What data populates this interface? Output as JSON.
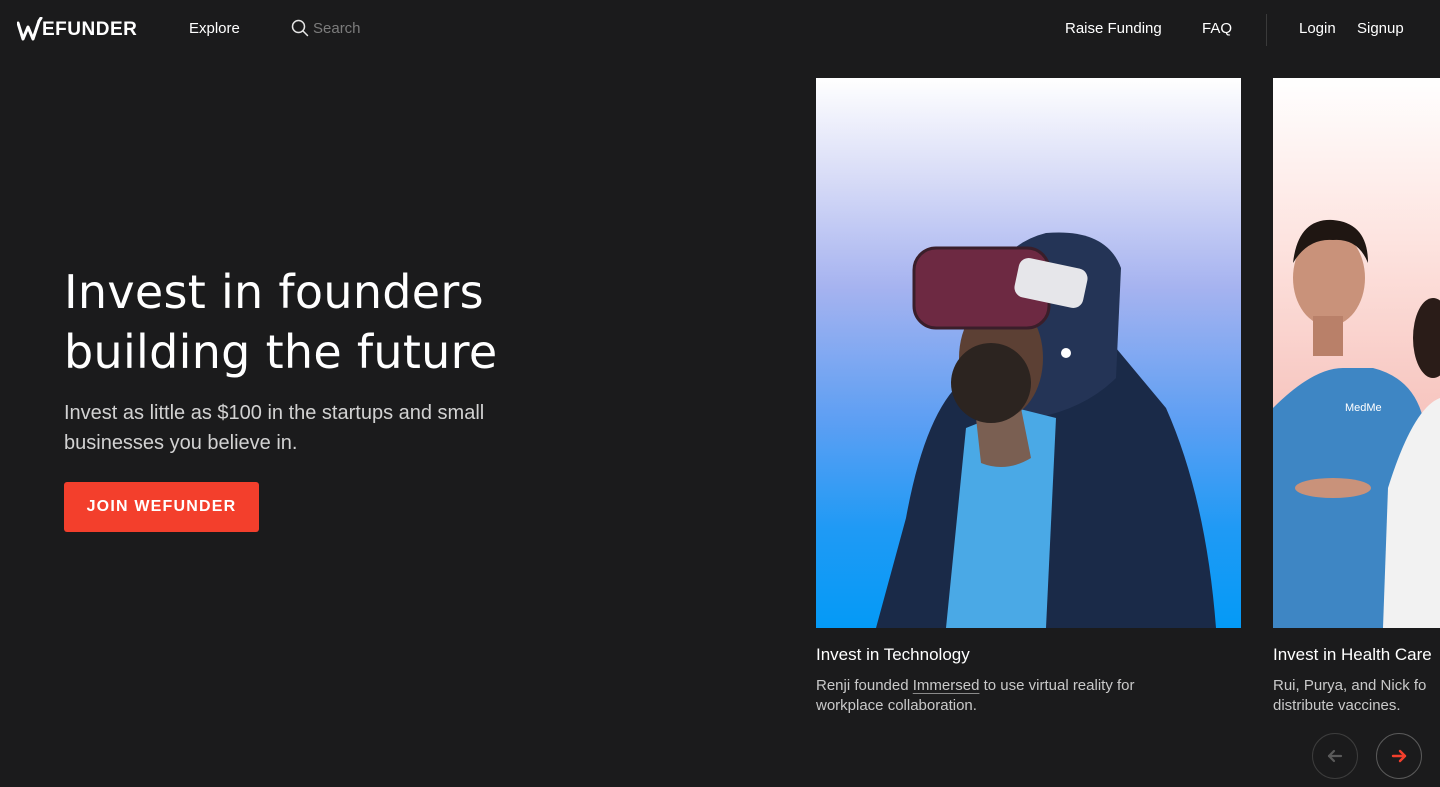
{
  "header": {
    "logo_text": "EFUNDER",
    "explore_label": "Explore",
    "search_placeholder": "Search",
    "raise_funding_label": "Raise Funding",
    "faq_label": "FAQ",
    "login_label": "Login",
    "signup_label": "Signup"
  },
  "hero": {
    "title_line1": "Invest in founders",
    "title_line2": "building the future",
    "subtitle_line1": "Invest as little as $100 in the startups and small",
    "subtitle_line2": "businesses you believe in.",
    "cta_label": "JOIN WEFUNDER"
  },
  "cards": [
    {
      "title": "Invest in Technology",
      "desc_before": "Renji founded ",
      "desc_link": "Immersed",
      "desc_after": " to use virtual reality for",
      "desc_line2": "workplace collaboration.",
      "image_icon": "vr-headset-person-image"
    },
    {
      "title": "Invest in Health Care",
      "desc_line1": "Rui, Purya, and Nick fo",
      "desc_line2": "distribute vaccines.",
      "image_icon": "health-care-founders-image"
    }
  ],
  "carousel": {
    "prev_icon": "arrow-left-icon",
    "next_icon": "arrow-right-icon"
  },
  "colors": {
    "background": "#1b1b1c",
    "accent": "#f33f2c",
    "text_muted": "#c9c9c9"
  }
}
